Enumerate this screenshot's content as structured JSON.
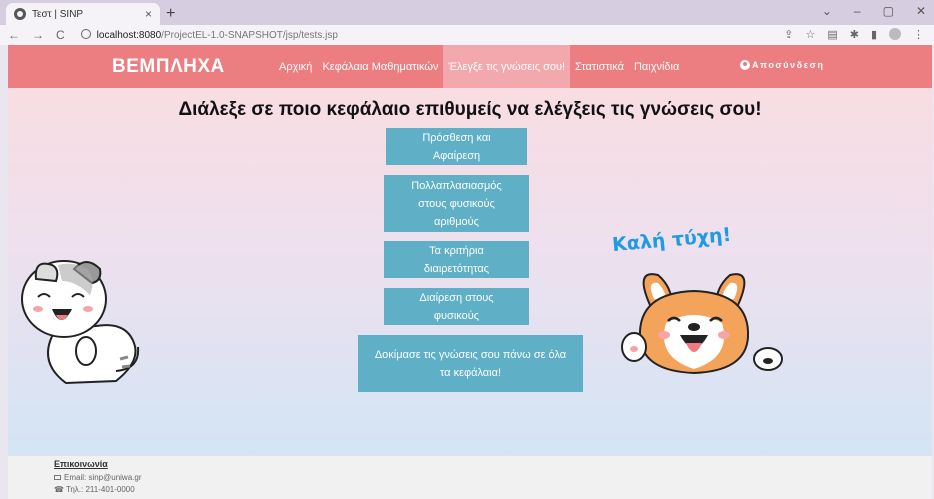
{
  "browser": {
    "tab_title": "Τεστ | SINP",
    "tab_close": "×",
    "new_tab": "+",
    "url_host": "localhost:8080",
    "url_path": "/ProjectEL-1.0-SNAPSHOT/jsp/tests.jsp",
    "window_controls": [
      "⌄",
      "–",
      "▢",
      "✕"
    ]
  },
  "navbar": {
    "brand": "ΒΕΜΠΛΗΧΑ",
    "links": [
      "Αρχική",
      "Κεφάλαια Μαθηματικών",
      "Έλεγξε τις γνώσεις σου!",
      "Στατιστικά",
      "Παιχνίδια"
    ],
    "active_index": 2,
    "logout": "Αποσύνδεση"
  },
  "main": {
    "heading": "Διάλεξε σε ποιο κεφάλαιο επιθυμείς να ελέγξεις τις γνώσεις σου!",
    "chapters": [
      "Πρόσθεση και Αφαίρεση",
      "Πολλαπλασιασμός στους φυσικούς αριθμούς",
      "Τα κριτήρια διαιρετότητας",
      "Διαίρεση στους φυσικούς",
      "Δοκίμασε τις γνώσεις σου πάνω σε όλα τα κεφάλαια!"
    ],
    "good_luck": "Καλή τύχη!"
  },
  "footer": {
    "title": "Επικοινωνία",
    "email": "Email: sinp@uniwa.gr",
    "phone": "Τηλ.: 211-401-0000"
  },
  "colors": {
    "navbar": "#ec7d80",
    "active_link": "#f3a8ad",
    "button": "#5fafc6",
    "good_luck": "#1f9be4"
  }
}
